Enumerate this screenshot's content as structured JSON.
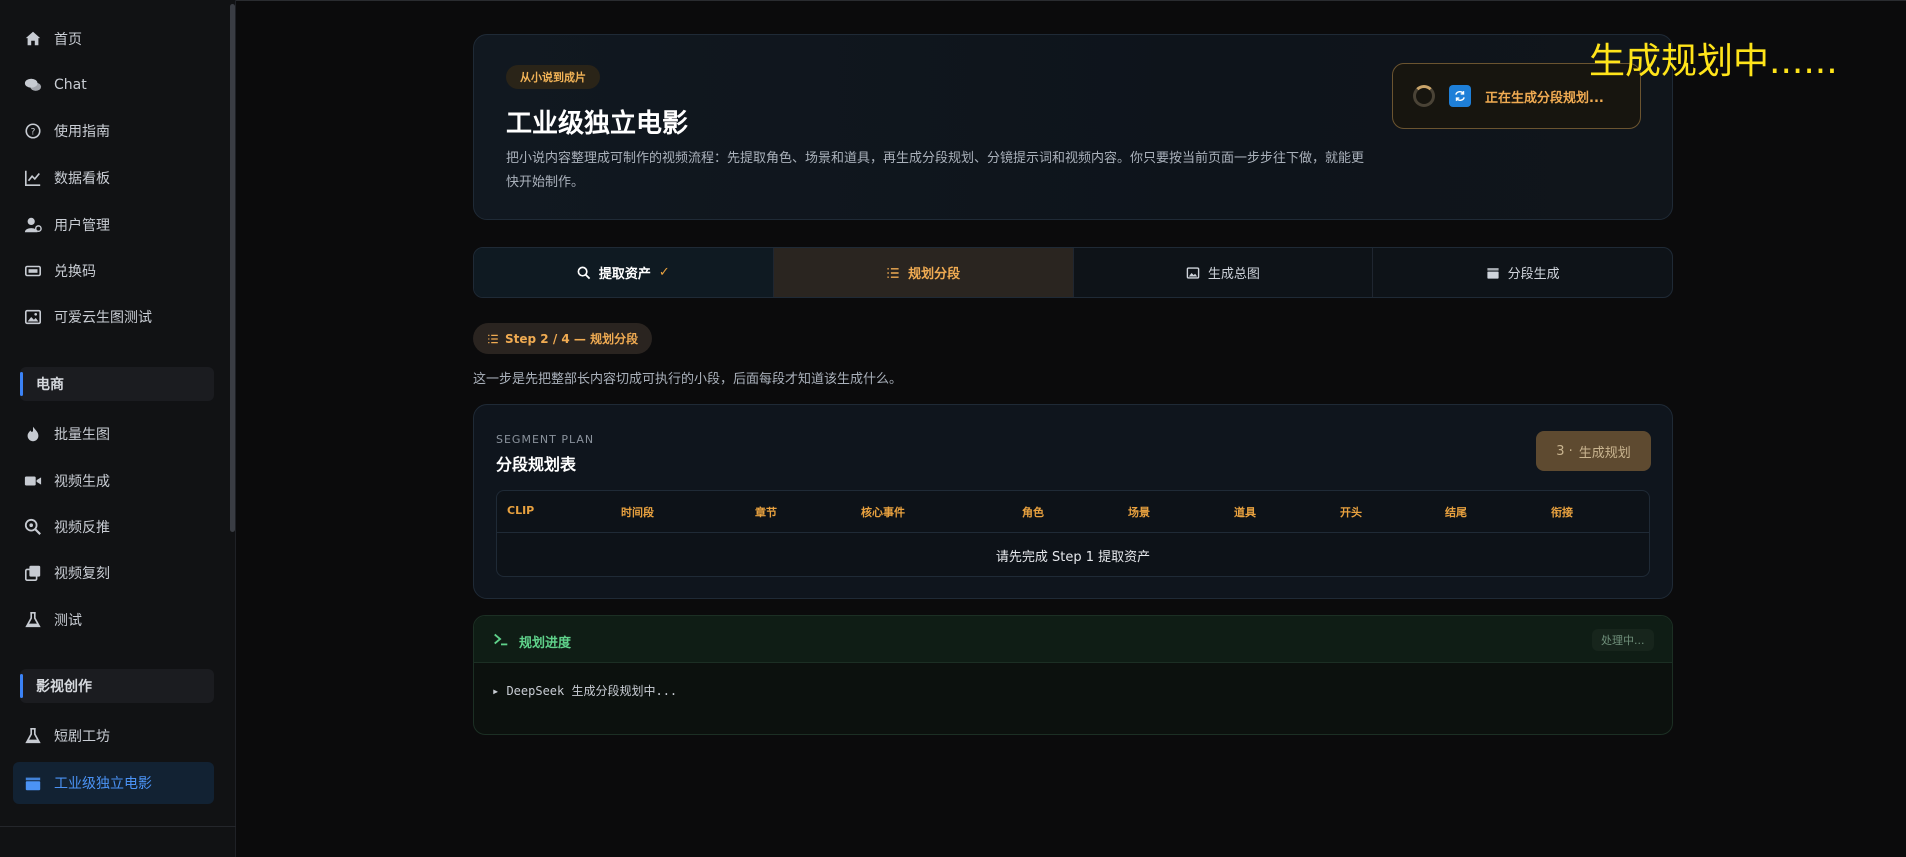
{
  "sidebar": {
    "items_top": [
      {
        "label": "首页",
        "icon": "home-icon"
      },
      {
        "label": "Chat",
        "icon": "chat-icon"
      },
      {
        "label": "使用指南",
        "icon": "help-icon"
      },
      {
        "label": "数据看板",
        "icon": "chart-icon"
      },
      {
        "label": "用户管理",
        "icon": "user-gear-icon"
      },
      {
        "label": "兑换码",
        "icon": "ticket-icon"
      },
      {
        "label": "可爱云生图测试",
        "icon": "image-icon"
      }
    ],
    "section_ecommerce": "电商",
    "items_ecommerce": [
      {
        "label": "批量生图",
        "icon": "fire-icon"
      },
      {
        "label": "视频生成",
        "icon": "video-icon"
      },
      {
        "label": "视频反推",
        "icon": "search-zoom-icon"
      },
      {
        "label": "视频复刻",
        "icon": "copy-icon"
      },
      {
        "label": "测试",
        "icon": "flask-icon"
      }
    ],
    "section_film": "影视创作",
    "items_film": [
      {
        "label": "短剧工坊",
        "icon": "flask-icon"
      },
      {
        "label": "工业级独立电影",
        "icon": "clapper-icon",
        "active": true
      }
    ],
    "active_color": "#3b82f6"
  },
  "hero": {
    "tag": "从小说到成片",
    "title": "工业级独立电影",
    "description": "把小说内容整理成可制作的视频流程：先提取角色、场景和道具，再生成分段规划、分镜提示词和视频内容。你只要按当前页面一步步往下做，就能更快开始制作。",
    "status": "正在生成分段规划..."
  },
  "overlay_text": "生成规划中......",
  "tabs": [
    {
      "label": "提取资产",
      "state": "done",
      "icon": "search-icon"
    },
    {
      "label": "规划分段",
      "state": "active",
      "icon": "list-icon"
    },
    {
      "label": "生成总图",
      "state": "idle",
      "icon": "image-icon"
    },
    {
      "label": "分段生成",
      "state": "idle",
      "icon": "clapper-icon"
    }
  ],
  "step": {
    "pill": "Step 2 / 4 — 规划分段",
    "description": "这一步是先把整部长内容切成可执行的小段，后面每段才知道该生成什么。"
  },
  "plan": {
    "eyebrow": "SEGMENT PLAN",
    "title": "分段规划表",
    "button_num": "3 ·",
    "button_label": "生成规划",
    "columns": [
      "CLIP",
      "时间段",
      "章节",
      "核心事件",
      "角色",
      "场景",
      "道具",
      "开头",
      "结尾",
      "衔接"
    ],
    "empty_text": "请先完成 Step 1 提取资产"
  },
  "progress": {
    "title": "规划进度",
    "badge": "处理中...",
    "log": "▸ DeepSeek 生成分段规划中..."
  },
  "colors": {
    "accent": "#f0ab52",
    "success": "#5fd18a",
    "overlay": "#ffe41a"
  }
}
